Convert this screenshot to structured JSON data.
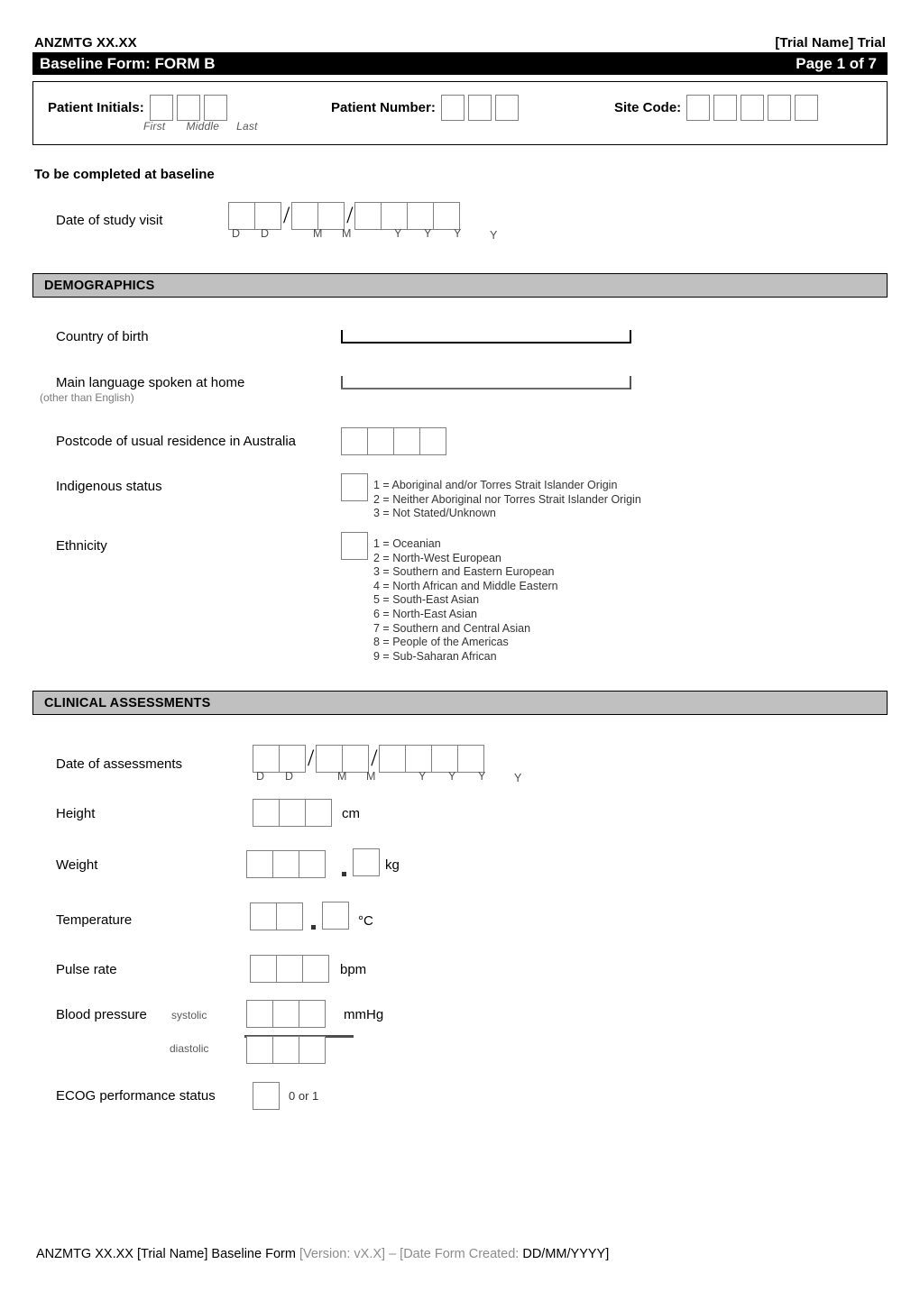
{
  "header": {
    "trial_code": "ANZMTG XX.XX",
    "trial_name": "[Trial Name] Trial",
    "form_title": "Baseline Form: FORM B",
    "page_label": "Page 1 of 7"
  },
  "patient_id": {
    "initials_label": "Patient Initials:",
    "initials_sub_first": "First",
    "initials_sub_middle": "Middle",
    "initials_sub_last": "Last",
    "number_label": "Patient Number:",
    "site_label": "Site Code:"
  },
  "baseline_note": "To be completed at baseline",
  "study_visit": {
    "label": "Date of study visit",
    "d1": "D",
    "d2": "D",
    "m1": "M",
    "m2": "M",
    "y1": "Y",
    "y2": "Y",
    "y3": "Y",
    "y4": "Y",
    "sep": "/"
  },
  "demographics": {
    "section_title": "DEMOGRAPHICS",
    "country_label": "Country of birth",
    "language_label": "Main language spoken at home",
    "language_sub": "(other than English)",
    "postcode_label": "Postcode of usual residence in Australia",
    "indigenous_label": "Indigenous status",
    "indigenous_options": "1 = Aboriginal and/or Torres Strait Islander Origin\n2 = Neither Aboriginal nor Torres Strait Islander Origin\n3 = Not Stated/Unknown",
    "ethnicity_label": "Ethnicity",
    "ethnicity_options": "1 = Oceanian\n2 = North-West European\n3 = Southern and Eastern European\n4 = North African and Middle Eastern\n5 = South-East Asian\n6 = North-East Asian\n7 = Southern and Central Asian\n8 = People of the Americas\n9 = Sub-Saharan African"
  },
  "clinical": {
    "section_title": "CLINICAL ASSESSMENTS",
    "assessment_date_label": "Date of assessments",
    "d1": "D",
    "d2": "D",
    "m1": "M",
    "m2": "M",
    "y1": "Y",
    "y2": "Y",
    "y3": "Y",
    "y4": "Y",
    "sep": "/",
    "height_label": "Height",
    "height_unit": "cm",
    "weight_label": "Weight",
    "weight_unit": "kg",
    "temperature_label": "Temperature",
    "temperature_unit": "°C",
    "pulse_label": "Pulse rate",
    "pulse_unit": "bpm",
    "bp_label": "Blood pressure",
    "bp_systolic_label": "systolic",
    "bp_diastolic_label": "diastolic",
    "bp_unit": "mmHg",
    "ecog_label": "ECOG performance status",
    "ecog_hint": "0 or 1"
  },
  "footer": {
    "part1": "ANZMTG XX.XX [Trial Name] Baseline Form ",
    "part2": "[Version: vX.X] – [Date Form Created: ",
    "part3": "DD/MM/YYYY]"
  }
}
